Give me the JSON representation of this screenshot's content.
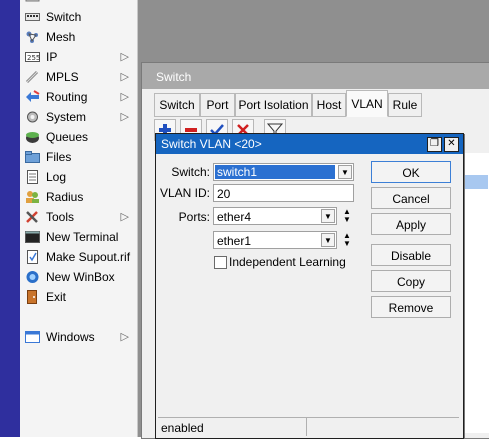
{
  "menu": {
    "items": [
      {
        "label": "Switch",
        "icon": "switch-icon",
        "submenu": false
      },
      {
        "label": "Mesh",
        "icon": "mesh-icon",
        "submenu": false
      },
      {
        "label": "IP",
        "icon": "ip-icon",
        "submenu": true
      },
      {
        "label": "MPLS",
        "icon": "mpls-icon",
        "submenu": true
      },
      {
        "label": "Routing",
        "icon": "routing-icon",
        "submenu": true
      },
      {
        "label": "System",
        "icon": "system-icon",
        "submenu": true
      },
      {
        "label": "Queues",
        "icon": "queues-icon",
        "submenu": false
      },
      {
        "label": "Files",
        "icon": "files-icon",
        "submenu": false
      },
      {
        "label": "Log",
        "icon": "log-icon",
        "submenu": false
      },
      {
        "label": "Radius",
        "icon": "radius-icon",
        "submenu": false
      },
      {
        "label": "Tools",
        "icon": "tools-icon",
        "submenu": true
      },
      {
        "label": "New Terminal",
        "icon": "terminal-icon",
        "submenu": false
      },
      {
        "label": "Make Supout.rif",
        "icon": "supout-icon",
        "submenu": false
      },
      {
        "label": "New WinBox",
        "icon": "winbox-icon",
        "submenu": false
      },
      {
        "label": "Exit",
        "icon": "exit-icon",
        "submenu": false
      },
      {
        "label": "Windows",
        "icon": "windows-icon",
        "submenu": true
      }
    ],
    "submenu_glyph": "▷"
  },
  "switch_window": {
    "title": "Switch",
    "tabs": [
      "Switch",
      "Port",
      "Port Isolation",
      "Host",
      "VLAN",
      "Rule"
    ],
    "active_tab": "VLAN"
  },
  "dialog": {
    "title": "Switch VLAN <20>",
    "restore_glyph": "❐",
    "close_glyph": "✕",
    "switch_label": "Switch:",
    "switch_value": "switch1",
    "vlan_id_label": "VLAN ID:",
    "vlan_id_value": "20",
    "ports_label": "Ports:",
    "ports": [
      "ether4",
      "ether1"
    ],
    "independent_learning_label": "Independent Learning",
    "independent_learning_checked": false,
    "buttons": {
      "ok": "OK",
      "cancel": "Cancel",
      "apply": "Apply",
      "disable": "Disable",
      "copy": "Copy",
      "remove": "Remove"
    },
    "status": "enabled"
  },
  "colors": {
    "title_active": "#1565c0",
    "menu_strip": "#2f2f9e",
    "selection": "#2b70d1"
  }
}
